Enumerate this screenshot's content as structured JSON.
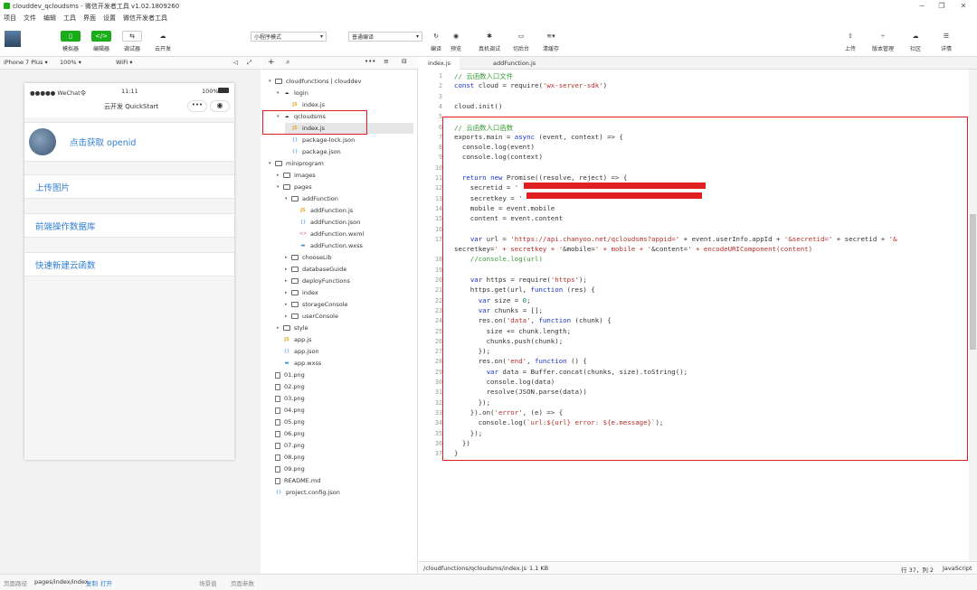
{
  "window": {
    "title": "clouddev_qcloudsms - 微信开发者工具 v1.02.1809260"
  },
  "menu": [
    "项目",
    "文件",
    "编辑",
    "工具",
    "界面",
    "设置",
    "微信开发者工具"
  ],
  "toolbar": {
    "simulator": "模拟器",
    "editor": "编辑器",
    "debugger": "调试器",
    "cloud": "云开发",
    "mode": "小程序模式",
    "compile": "普通编译",
    "compile_btn": "编译",
    "preview": "预览",
    "remote_debug": "真机调试",
    "switch_bg": "切后台",
    "clear_cache": "清缓存",
    "upload": "上传",
    "version": "版本管理",
    "community": "社区",
    "details": "详情"
  },
  "simbar": {
    "device": "iPhone 7 Plus",
    "zoom": "100%",
    "network": "WiFi"
  },
  "phone": {
    "carrier": "●●●●● WeChat令",
    "time": "11:11",
    "battery": "100%",
    "nav_title": "云开发 QuickStart",
    "items": [
      "点击获取 openid",
      "上传图片",
      "前端操作数据库",
      "快速新建云函数"
    ]
  },
  "tree": [
    {
      "label": "cloudfunctions | clouddev",
      "depth": 0,
      "type": "folder",
      "open": true
    },
    {
      "label": "login",
      "depth": 1,
      "type": "cloudfolder",
      "open": true
    },
    {
      "label": "index.js",
      "depth": 2,
      "type": "js"
    },
    {
      "label": "qcloudsms",
      "depth": 1,
      "type": "cloudfolder",
      "open": true
    },
    {
      "label": "index.js",
      "depth": 2,
      "type": "js",
      "selected": true
    },
    {
      "label": "package-lock.json",
      "depth": 2,
      "type": "json"
    },
    {
      "label": "package.json",
      "depth": 2,
      "type": "json"
    },
    {
      "label": "miniprogram",
      "depth": 0,
      "type": "folder",
      "open": true
    },
    {
      "label": "images",
      "depth": 1,
      "type": "folder",
      "open": false
    },
    {
      "label": "pages",
      "depth": 1,
      "type": "folder",
      "open": true
    },
    {
      "label": "addFunction",
      "depth": 2,
      "type": "folder",
      "open": true
    },
    {
      "label": "addFunction.js",
      "depth": 3,
      "type": "js"
    },
    {
      "label": "addFunction.json",
      "depth": 3,
      "type": "json"
    },
    {
      "label": "addFunction.wxml",
      "depth": 3,
      "type": "wxml"
    },
    {
      "label": "addFunction.wxss",
      "depth": 3,
      "type": "wxss"
    },
    {
      "label": "chooseLib",
      "depth": 2,
      "type": "folder",
      "open": false
    },
    {
      "label": "databaseGuide",
      "depth": 2,
      "type": "folder",
      "open": false
    },
    {
      "label": "deployFunctions",
      "depth": 2,
      "type": "folder",
      "open": false
    },
    {
      "label": "index",
      "depth": 2,
      "type": "folder",
      "open": false
    },
    {
      "label": "storageConsole",
      "depth": 2,
      "type": "folder",
      "open": false
    },
    {
      "label": "userConsole",
      "depth": 2,
      "type": "folder",
      "open": false
    },
    {
      "label": "style",
      "depth": 1,
      "type": "folder",
      "open": false
    },
    {
      "label": "app.js",
      "depth": 1,
      "type": "js"
    },
    {
      "label": "app.json",
      "depth": 1,
      "type": "json"
    },
    {
      "label": "app.wxss",
      "depth": 1,
      "type": "wxss"
    },
    {
      "label": "01.png",
      "depth": 0,
      "type": "img"
    },
    {
      "label": "02.png",
      "depth": 0,
      "type": "img"
    },
    {
      "label": "03.png",
      "depth": 0,
      "type": "img"
    },
    {
      "label": "04.png",
      "depth": 0,
      "type": "img"
    },
    {
      "label": "05.png",
      "depth": 0,
      "type": "img"
    },
    {
      "label": "06.png",
      "depth": 0,
      "type": "img"
    },
    {
      "label": "07.png",
      "depth": 0,
      "type": "img"
    },
    {
      "label": "08.png",
      "depth": 0,
      "type": "img"
    },
    {
      "label": "09.png",
      "depth": 0,
      "type": "img"
    },
    {
      "label": "README.md",
      "depth": 0,
      "type": "md"
    },
    {
      "label": "project.config.json",
      "depth": 0,
      "type": "json"
    }
  ],
  "tabs": [
    "index.js",
    "addFunction.js"
  ],
  "code": [
    {
      "n": "1",
      "t": "// 云函数入口文件"
    },
    {
      "n": "2",
      "t": "const cloud = require('wx-server-sdk')"
    },
    {
      "n": "3",
      "t": ""
    },
    {
      "n": "4",
      "t": "cloud.init()"
    },
    {
      "n": "5",
      "t": ""
    },
    {
      "n": "6",
      "t": "// 云函数入口函数"
    },
    {
      "n": "7",
      "t": "exports.main = async (event, context) => {"
    },
    {
      "n": "8",
      "t": "  console.log(event)"
    },
    {
      "n": "9",
      "t": "  console.log(context)"
    },
    {
      "n": "10",
      "t": ""
    },
    {
      "n": "11",
      "t": "  return new Promise((resolve, reject) => {"
    },
    {
      "n": "12",
      "t": "    secretid = '"
    },
    {
      "n": "13",
      "t": "    secretkey = '"
    },
    {
      "n": "14",
      "t": "    mobile = event.mobile"
    },
    {
      "n": "15",
      "t": "    content = event.content"
    },
    {
      "n": "16",
      "t": ""
    },
    {
      "n": "17",
      "t": "    var url = 'https://api.chanyoo.net/qcloudsms?appid=' + event.userInfo.appId + '&secretid=' + secretid + '&"
    },
    {
      "n": "",
      "t": "secretkey=' + secretkey + '&mobile=' + mobile + '&content=' + encodeURIComponent(content)"
    },
    {
      "n": "18",
      "t": "    //console.log(url)"
    },
    {
      "n": "19",
      "t": ""
    },
    {
      "n": "20",
      "t": "    var https = require('https');"
    },
    {
      "n": "21",
      "t": "    https.get(url, function (res) {"
    },
    {
      "n": "22",
      "t": "      var size = 0;"
    },
    {
      "n": "23",
      "t": "      var chunks = [];"
    },
    {
      "n": "24",
      "t": "      res.on('data', function (chunk) {"
    },
    {
      "n": "25",
      "t": "        size += chunk.length;"
    },
    {
      "n": "26",
      "t": "        chunks.push(chunk);"
    },
    {
      "n": "27",
      "t": "      });"
    },
    {
      "n": "28",
      "t": "      res.on('end', function () {"
    },
    {
      "n": "29",
      "t": "        var data = Buffer.concat(chunks, size).toString();"
    },
    {
      "n": "30",
      "t": "        console.log(data)"
    },
    {
      "n": "31",
      "t": "        resolve(JSON.parse(data))"
    },
    {
      "n": "32",
      "t": "      });"
    },
    {
      "n": "33",
      "t": "    }).on('error', (e) => {"
    },
    {
      "n": "34",
      "t": "      console.log(`url:${url} error: ${e.message}`);"
    },
    {
      "n": "35",
      "t": "    });"
    },
    {
      "n": "36",
      "t": "  })"
    },
    {
      "n": "37",
      "t": "}"
    }
  ],
  "editor_status": {
    "path": "/cloudfunctions/qcloudsms/index.js",
    "size": "1.1 KB",
    "pos": "行 37，列 2",
    "lang": "JavaScript"
  },
  "bottom": {
    "path_label": "页面路径",
    "path": "pages/index/index",
    "copy": "复制",
    "open": "打开",
    "scene": "场景值",
    "params": "页面参数"
  },
  "colors": {
    "accent": "#1aad19",
    "highlight_box": "#e02020",
    "link": "#2f7fd3"
  }
}
